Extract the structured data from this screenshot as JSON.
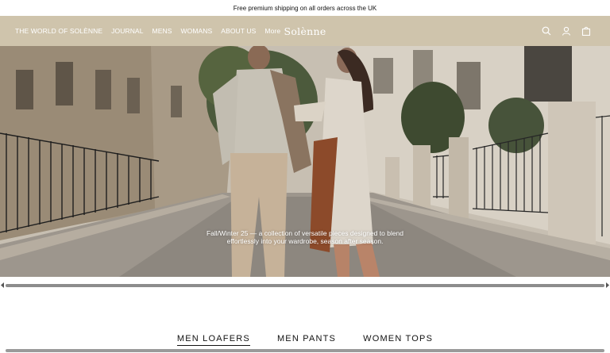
{
  "announcement": "Free premium shipping on all orders across the UK",
  "nav": {
    "links": [
      "THE WORLD OF SOLÈNNE",
      "JOURNAL",
      "MENS",
      "WOMANS",
      "ABOUT US",
      "More"
    ],
    "logo": "Solènne",
    "icons": [
      "search-icon",
      "account-icon",
      "bag-icon"
    ]
  },
  "hero": {
    "caption_line1": "Fall/Winter 25 — a collection of versatile pieces designed to blend",
    "caption_line2": "effortlessly into your wardrobe, season after season."
  },
  "tabs": {
    "items": [
      "MEN LOAFERS",
      "MEN PANTS",
      "WOMEN TOPS"
    ],
    "active_index": 0
  },
  "colors": {
    "nav_background": "#cfc4ac",
    "text_on_nav": "#ffffff",
    "scrollbar_thumb": "#8c8c8c"
  }
}
